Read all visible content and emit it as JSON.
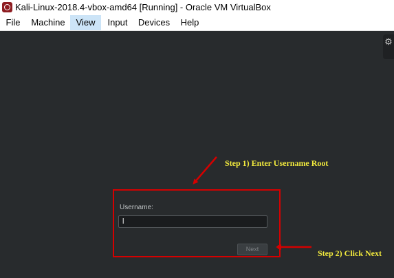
{
  "window": {
    "title": "Kali-Linux-2018.4-vbox-amd64 [Running] - Oracle VM VirtualBox",
    "icon": "virtualbox-icon"
  },
  "menu": {
    "items": [
      {
        "label": "File"
      },
      {
        "label": "Machine"
      },
      {
        "label": "View",
        "active": true
      },
      {
        "label": "Input"
      },
      {
        "label": "Devices"
      },
      {
        "label": "Help"
      }
    ]
  },
  "side_tab": {
    "icon": "gear-icon",
    "glyph": "⚙"
  },
  "login": {
    "username_label": "Username:",
    "username_value": "l",
    "next_label": "Next"
  },
  "annotations": {
    "step1": "Step 1) Enter Username Root",
    "step2": "Step 2) Click Next"
  },
  "colors": {
    "annotation_red": "#d50000",
    "annotation_yellow": "#f2ea3d",
    "desktop_bg": "#282b2d",
    "menu_highlight": "#cce4f7"
  }
}
